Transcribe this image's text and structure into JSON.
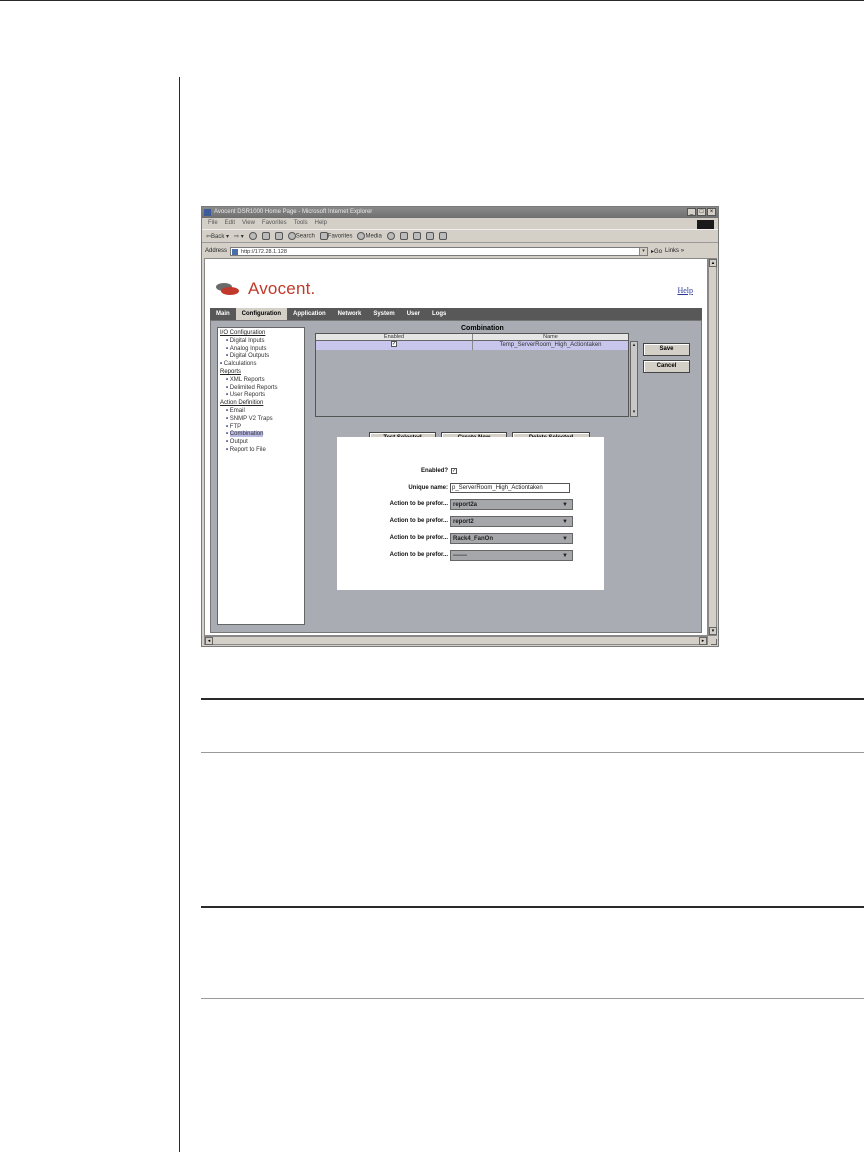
{
  "browser": {
    "title": "Avocent DSR1000 Home Page - Microsoft Internet Explorer",
    "window_controls": [
      "_",
      "□",
      "×"
    ],
    "menu": [
      "File",
      "Edit",
      "View",
      "Favorites",
      "Tools",
      "Help"
    ],
    "toolbar": {
      "back": "Back",
      "search": "Search",
      "favorites": "Favorites",
      "media": "Media"
    },
    "address_label": "Address",
    "address_value": "http://172.28.1.128",
    "go_label": "Go",
    "links_label": "Links »"
  },
  "app": {
    "logo_text": "Avocent.",
    "help_link": "Help",
    "tabs": [
      "Main",
      "Configuration",
      "Application",
      "Network",
      "System",
      "User",
      "Logs"
    ],
    "active_tab": "Configuration",
    "tree": {
      "io_header": "I/O Configuration",
      "digital_inputs": "Digital Inputs",
      "analog_inputs": "Analog Inputs",
      "digital_outputs": "Digital Outputs",
      "calculations": "Calculations",
      "reports_header": "Reports",
      "xml_reports": "XML Reports",
      "delimited_reports": "Delimited Reports",
      "user_reports": "User Reports",
      "action_header": "Action Definition",
      "email": "Email",
      "snmp": "SNMP V2 Traps",
      "ftp": "FTP",
      "combination": "Combination",
      "output": "Output",
      "report_to_file": "Report to File"
    },
    "combination": {
      "title": "Combination",
      "col_enabled": "Enabled",
      "col_name": "Name",
      "row": {
        "enabled_mark": "✓",
        "name": "Temp_ServerRoom_High_Actiontaken"
      }
    },
    "buttons": {
      "save": "Save",
      "cancel": "Cancel",
      "test_selected": "Test Selected",
      "create_new": "Create New",
      "delete_selected": "Delete Selected"
    },
    "form": {
      "enabled_label": "Enabled?",
      "enabled_mark": "✓",
      "unique_name_label": "Unique name:",
      "unique_name_value": "p_ServerRoom_High_Actiontaken",
      "action_label": "Action to be prefor...",
      "actions": [
        "report2a",
        "report2",
        "Rack4_FanOn",
        "-------"
      ]
    }
  }
}
